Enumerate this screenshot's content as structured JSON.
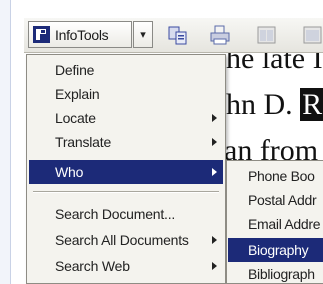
{
  "document": {
    "line1": "he late",
    "line1_tail": "I",
    "line2_pre": "hn D.",
    "line2_hl": "Ro",
    "line3": "an from"
  },
  "toolbar": {
    "app_label": "InfoTools",
    "dropdown_glyph": "▾"
  },
  "menu": {
    "items": [
      {
        "label": "Define",
        "has_submenu": false
      },
      {
        "label": "Explain",
        "has_submenu": false
      },
      {
        "label": "Locate",
        "has_submenu": true
      },
      {
        "label": "Translate",
        "has_submenu": true
      },
      {
        "label": "Who",
        "has_submenu": true,
        "selected": true
      },
      {
        "label": "Search Document...",
        "has_submenu": false
      },
      {
        "label": "Search All Documents",
        "has_submenu": true
      },
      {
        "label": "Search Web",
        "has_submenu": true
      }
    ]
  },
  "submenu": {
    "items": [
      {
        "label": "Phone Boo"
      },
      {
        "label": "Postal Addr"
      },
      {
        "label": "Email Addre"
      },
      {
        "label": "Biography",
        "selected": true
      },
      {
        "label": "Bibliograph"
      }
    ]
  },
  "colors": {
    "selection": "#1c2a78",
    "menu_bg": "#f4f3ee",
    "toolbar_icon_blue": "#1c2a78"
  },
  "icons": [
    "infotools-logo-icon",
    "chevron-down-icon",
    "copy-icon",
    "print-icon",
    "window-icon"
  ]
}
